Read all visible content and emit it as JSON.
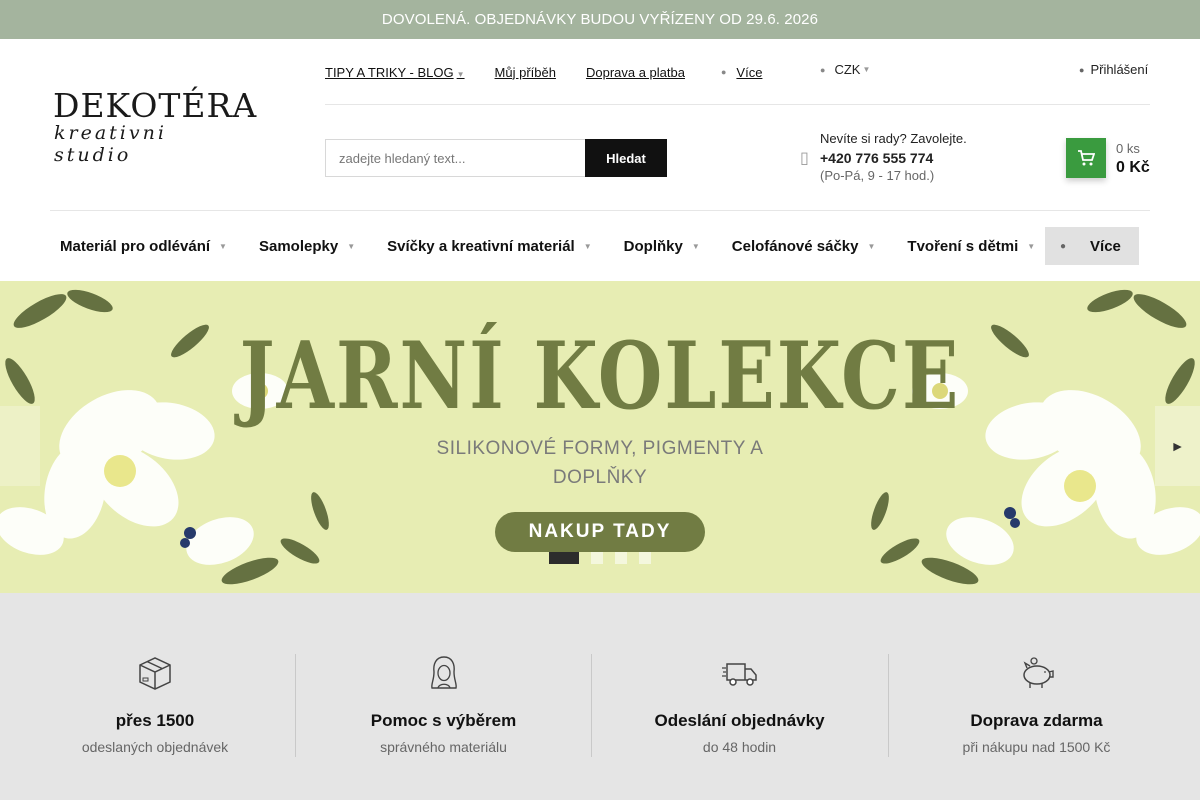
{
  "announcement": "DOVOLENÁ. OBJEDNÁVKY BUDOU VYŘÍZENY OD 29.6. 2026",
  "logo": {
    "main": "DEKOTÉRA",
    "sub": "kreativni studio"
  },
  "top_links": [
    {
      "label": "TIPY A TRIKY - BLOG"
    },
    {
      "label": "Můj příběh"
    },
    {
      "label": "Doprava a platba"
    }
  ],
  "top_more_label": "Více",
  "currency": "CZK",
  "login_label": "Přihlášení",
  "search": {
    "placeholder": "zadejte hledaný text...",
    "button_label": "Hledat"
  },
  "contact": {
    "prompt": "Nevíte si rady? Zavolejte.",
    "phone": "+420 776 555 774",
    "hours": "(Po-Pá, 9 - 17 hod.)"
  },
  "cart": {
    "count": "0 ks",
    "total": "0 Kč"
  },
  "nav": [
    {
      "label": "Materiál pro odlévání"
    },
    {
      "label": "Samolepky"
    },
    {
      "label": "Svíčky a kreativní materiál"
    },
    {
      "label": "Doplňky"
    },
    {
      "label": "Celofánové sáčky"
    },
    {
      "label": "Tvoření s dětmi"
    }
  ],
  "nav_more_label": "Více",
  "banner": {
    "title": "JARNÍ KOLEKCE",
    "subtitle": "SILIKONOVÉ FORMY, PIGMENTY A DOPLŇKY",
    "cta": "NAKUP TADY",
    "slide_count": 4,
    "active_slide": 1
  },
  "features": [
    {
      "icon": "box-icon",
      "title": "přes 1500",
      "subtitle": "odeslaných objednávek"
    },
    {
      "icon": "woman-icon",
      "title": "Pomoc s výběrem",
      "subtitle": "správného materiálu"
    },
    {
      "icon": "truck-icon",
      "title": "Odeslání objednávky",
      "subtitle": "do 48 hodin"
    },
    {
      "icon": "piggy-bank-icon",
      "title": "Doprava zdarma",
      "subtitle": "při nákupu nad 1500 Kč"
    }
  ],
  "colors": {
    "topbar": "#a4b49e",
    "accent_green": "#3a9b3f",
    "banner_bg": "#e7edb3",
    "banner_text": "#717c43",
    "features_bg": "#e5e5e5"
  }
}
